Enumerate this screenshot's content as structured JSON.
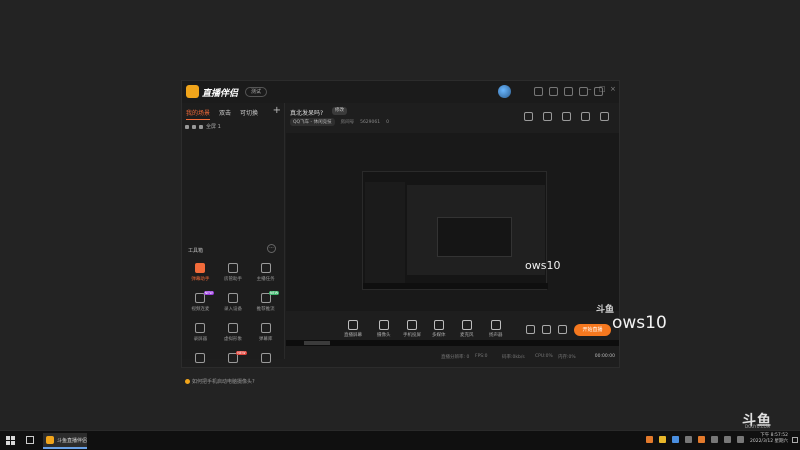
{
  "app": {
    "name": "直播伴侣",
    "version_label": "测试"
  },
  "left_panel": {
    "scene_tabs": [
      "我的场景",
      "双击",
      "可切换"
    ],
    "scene_add": "+",
    "scene_item": "全屏 1",
    "tools_title": "工具箱",
    "tools_more": "···",
    "tools": [
      {
        "label": "弹幕助手",
        "active": true,
        "badge": ""
      },
      {
        "label": "房管助手",
        "active": false,
        "badge": ""
      },
      {
        "label": "主播任务",
        "active": false,
        "badge": ""
      },
      {
        "label": "视频连麦",
        "active": false,
        "badge": "NEW"
      },
      {
        "label": "录入设备",
        "active": false,
        "badge": ""
      },
      {
        "label": "推荐推流",
        "active": false,
        "badge": "NEW"
      },
      {
        "label": "录屏器",
        "active": false,
        "badge": ""
      },
      {
        "label": "虚拟形象",
        "active": false,
        "badge": ""
      },
      {
        "label": "弹幕库",
        "active": false,
        "badge": ""
      },
      {
        "label": "",
        "active": false,
        "badge": ""
      },
      {
        "label": "",
        "active": false,
        "badge": "NEW"
      },
      {
        "label": "",
        "active": false,
        "badge": ""
      }
    ],
    "hint": "如何把手机启动电脑摄像头?"
  },
  "main": {
    "room_title": "真北发呆吗?",
    "room_edit": "修改",
    "category": "QQ飞车 - 休闲竞技",
    "room_label": "房间号",
    "room_id": "5629061",
    "fans": "0"
  },
  "preview": {
    "overlay_text_small": "ows10",
    "overlay_text_large": "ows10",
    "watermark": "斗鱼"
  },
  "toolbar": {
    "buttons": [
      "直播屏幕",
      "摄像头",
      "手机投屏",
      "多媒体",
      "麦克风",
      "扬声器"
    ],
    "start_button": "开始直播"
  },
  "status": {
    "items": [
      "直播分辨率: 0",
      "FPS:0",
      "码率:0kb/s",
      "CPU:0%",
      "内存:0%"
    ],
    "timer": "00:00:00"
  },
  "watermark": {
    "logo": "斗鱼",
    "sub": "DOUYU.COM"
  },
  "taskbar": {
    "app_label": "斗鱼直播伴侣",
    "time": "下午 8:57:52",
    "date": "2022/3/12 星期六"
  }
}
